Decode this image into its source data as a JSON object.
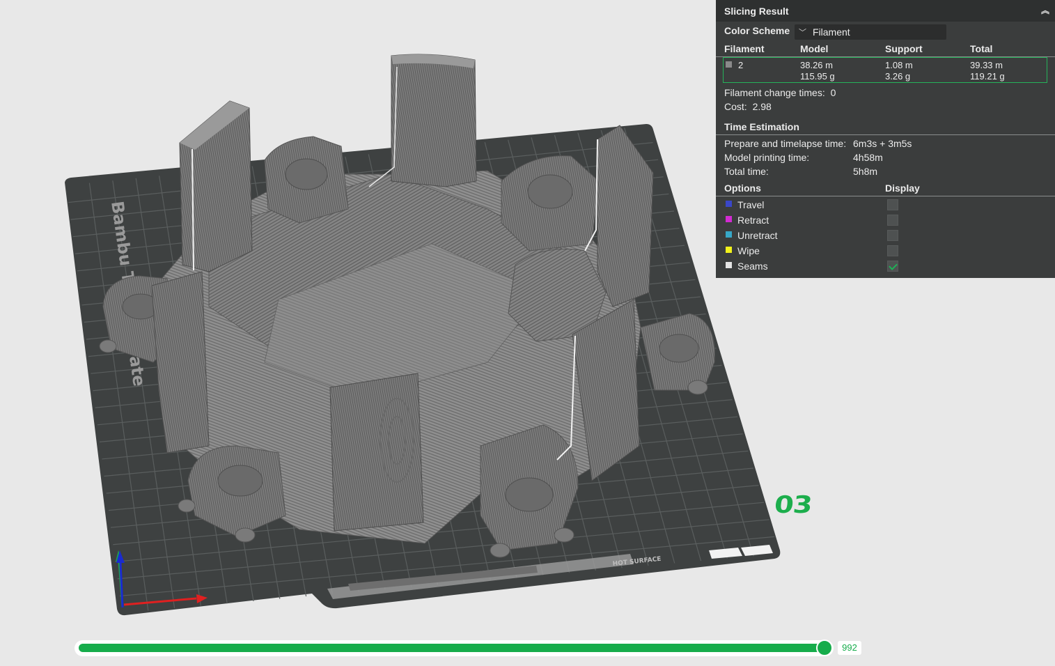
{
  "viewport": {
    "plate_brand_text": "Bambu Tex",
    "plate_brand_text2": "ate",
    "plate_label_text": "HOT SURFACE",
    "plate_number": "03",
    "axis_colors": {
      "x": "#e02020",
      "y": "#1ea050",
      "z": "#1a2bd0"
    }
  },
  "panel": {
    "title": "Slicing Result",
    "color_scheme_label": "Color Scheme",
    "color_scheme_value": "Filament",
    "columns": {
      "filament": "Filament",
      "model": "Model",
      "support": "Support",
      "total": "Total"
    },
    "filaments": [
      {
        "id": "2",
        "color": "#8a8a8a",
        "model_length": "38.26 m",
        "model_weight": "115.95 g",
        "support_length": "1.08 m",
        "support_weight": "3.26 g",
        "total_length": "39.33 m",
        "total_weight": "119.21 g"
      }
    ],
    "filament_change_label": "Filament change times:",
    "filament_change_value": "0",
    "cost_label": "Cost:",
    "cost_value": "2.98",
    "time_title": "Time Estimation",
    "prepare_label": "Prepare and timelapse time:",
    "prepare_value": "6m3s + 3m5s",
    "model_time_label": "Model printing time:",
    "model_time_value": "4h58m",
    "total_time_label": "Total time:",
    "total_time_value": "5h8m",
    "options_label": "Options",
    "display_label": "Display",
    "options": [
      {
        "label": "Travel",
        "color": "#3a47c8",
        "checked": false
      },
      {
        "label": "Retract",
        "color": "#d22bd2",
        "checked": false
      },
      {
        "label": "Unretract",
        "color": "#37a8c8",
        "checked": false
      },
      {
        "label": "Wipe",
        "color": "#f2f21c",
        "checked": false
      },
      {
        "label": "Seams",
        "color": "#e4e4e4",
        "checked": true
      }
    ]
  },
  "slider": {
    "value": "992",
    "fraction": 1.0
  }
}
